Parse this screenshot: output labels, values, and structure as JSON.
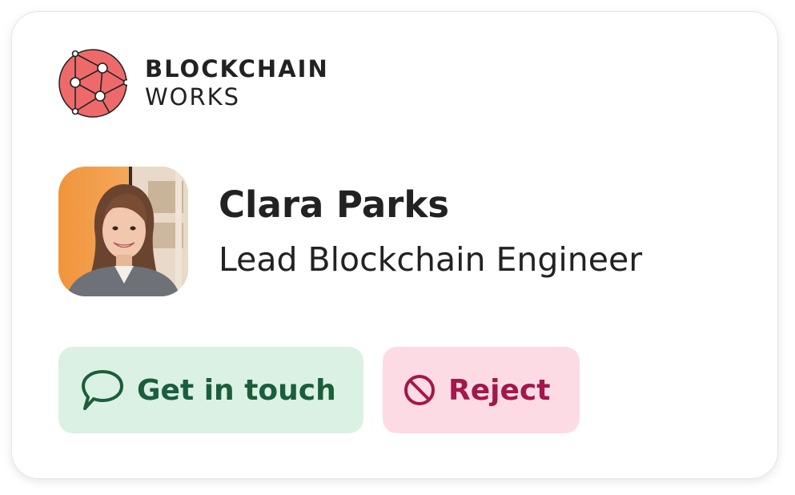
{
  "brand": {
    "line1": "BLOCKCHAIN",
    "line2": "WORKS",
    "logo_icon": "network-nodes-icon",
    "logo_color": "#ee6a6a"
  },
  "profile": {
    "name": "Clara Parks",
    "title": "Lead Blockchain Engineer",
    "avatar_icon": "profile-photo"
  },
  "actions": {
    "contact_label": "Get in touch",
    "contact_icon": "chat-bubble-icon",
    "contact_bg": "#daf1e3",
    "contact_color": "#1a5e3a",
    "reject_label": "Reject",
    "reject_icon": "ban-icon",
    "reject_bg": "#fddbe5",
    "reject_color": "#a3174a"
  }
}
